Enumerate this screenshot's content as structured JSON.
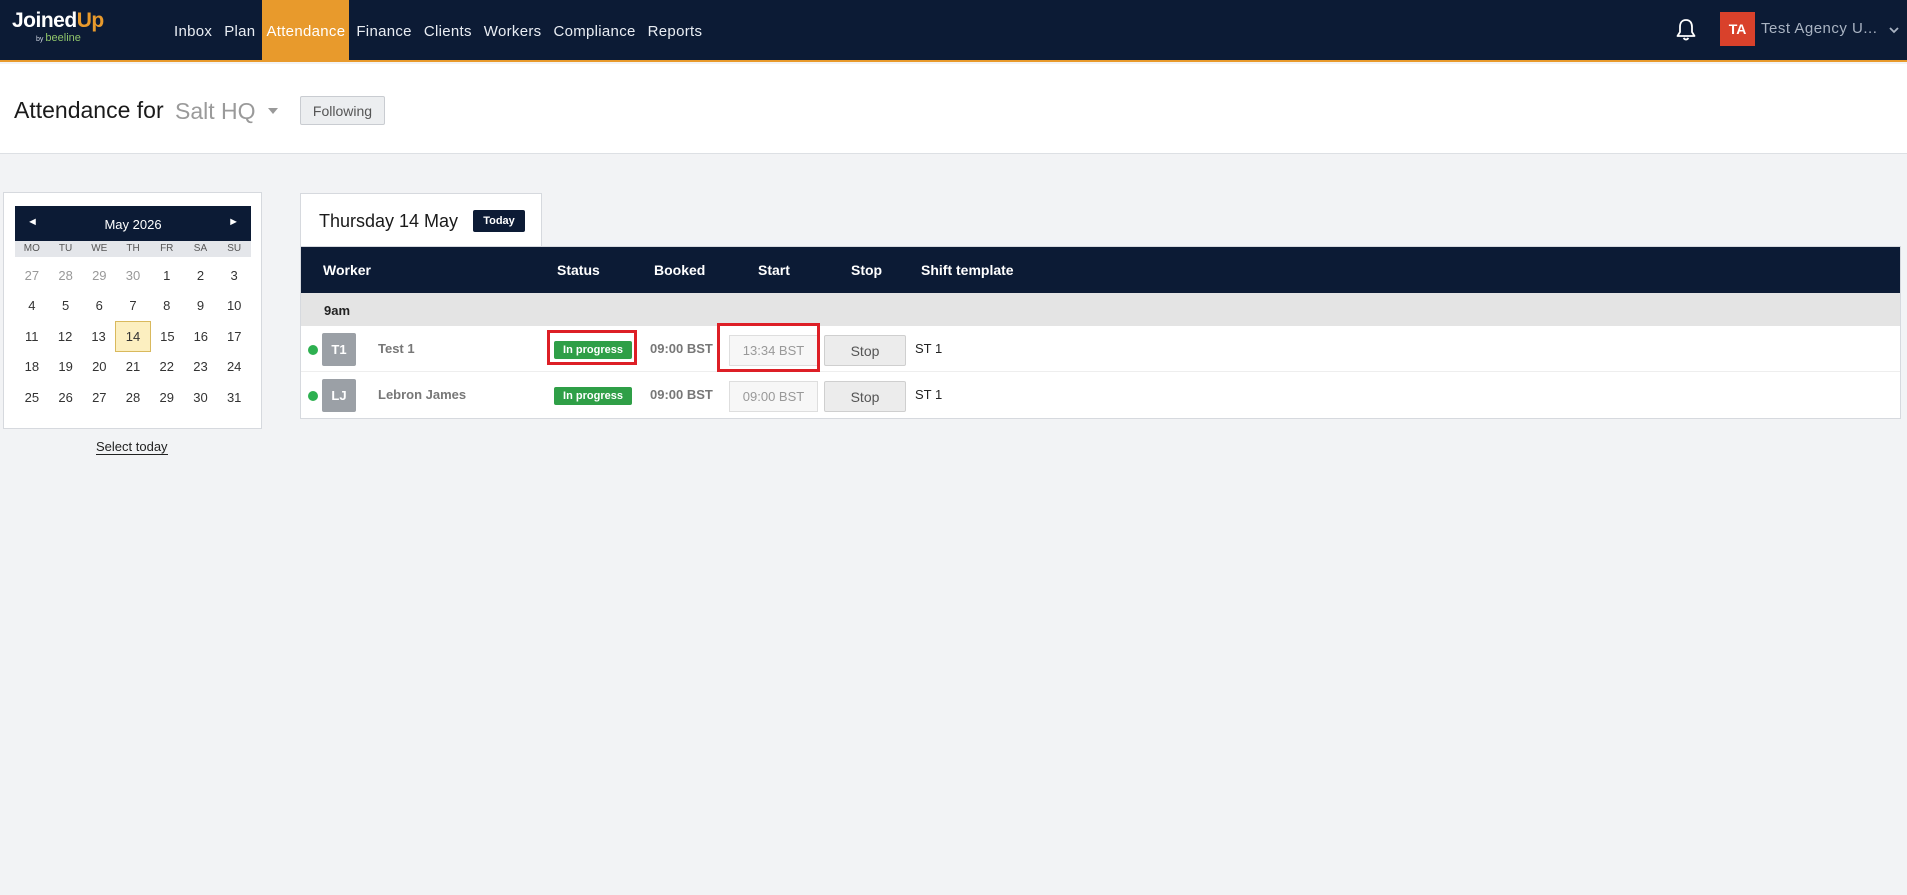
{
  "brand": {
    "name_part1": "Joined",
    "name_part2": "Up",
    "by": "by",
    "sub": "beeline"
  },
  "nav": {
    "items": [
      {
        "label": "Inbox",
        "active": false
      },
      {
        "label": "Plan",
        "active": false
      },
      {
        "label": "Attendance",
        "active": true
      },
      {
        "label": "Finance",
        "active": false
      },
      {
        "label": "Clients",
        "active": false
      },
      {
        "label": "Workers",
        "active": false
      },
      {
        "label": "Compliance",
        "active": false
      },
      {
        "label": "Reports",
        "active": false
      }
    ],
    "notifications_icon": "bell-icon",
    "user_initials": "TA",
    "user_name": "Test Agency U..."
  },
  "header": {
    "title": "Attendance for",
    "site": "Salt HQ",
    "following_label": "Following"
  },
  "calendar": {
    "month_label": "May 2026",
    "prev_glyph": "◄",
    "next_glyph": "►",
    "dow": [
      "MO",
      "TU",
      "WE",
      "TH",
      "FR",
      "SA",
      "SU"
    ],
    "weeks": [
      [
        {
          "d": "27",
          "other": true
        },
        {
          "d": "28",
          "other": true
        },
        {
          "d": "29",
          "other": true
        },
        {
          "d": "30",
          "other": true
        },
        {
          "d": "1"
        },
        {
          "d": "2"
        },
        {
          "d": "3"
        }
      ],
      [
        {
          "d": "4"
        },
        {
          "d": "5"
        },
        {
          "d": "6"
        },
        {
          "d": "7"
        },
        {
          "d": "8"
        },
        {
          "d": "9"
        },
        {
          "d": "10"
        }
      ],
      [
        {
          "d": "11"
        },
        {
          "d": "12"
        },
        {
          "d": "13"
        },
        {
          "d": "14",
          "selected": true
        },
        {
          "d": "15"
        },
        {
          "d": "16"
        },
        {
          "d": "17"
        }
      ],
      [
        {
          "d": "18"
        },
        {
          "d": "19"
        },
        {
          "d": "20"
        },
        {
          "d": "21"
        },
        {
          "d": "22"
        },
        {
          "d": "23"
        },
        {
          "d": "24"
        }
      ],
      [
        {
          "d": "25"
        },
        {
          "d": "26"
        },
        {
          "d": "27"
        },
        {
          "d": "28"
        },
        {
          "d": "29"
        },
        {
          "d": "30"
        },
        {
          "d": "31"
        }
      ]
    ],
    "select_today": "Select today"
  },
  "day": {
    "label": "Thursday 14 May",
    "today_badge": "Today"
  },
  "table": {
    "headers": {
      "worker": "Worker",
      "status": "Status",
      "booked": "Booked",
      "start": "Start",
      "stop": "Stop",
      "shift_template": "Shift template"
    },
    "group_label": "9am",
    "rows": [
      {
        "initials": "T1",
        "name": "Test 1",
        "status": "In progress",
        "booked": "09:00 BST",
        "start": "13:34 BST",
        "stop_label": "Stop",
        "shift_template": "ST 1"
      },
      {
        "initials": "LJ",
        "name": "Lebron James",
        "status": "In progress",
        "booked": "09:00 BST",
        "start": "09:00 BST",
        "stop_label": "Stop",
        "shift_template": "ST 1"
      }
    ]
  },
  "colors": {
    "nav_bg": "#0c1b35",
    "accent": "#e89a2c",
    "status_green": "#2f9f47",
    "online_dot": "#2db050",
    "highlight_red": "#dd1f26"
  }
}
